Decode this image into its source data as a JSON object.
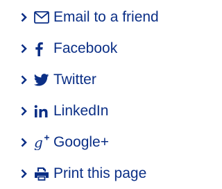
{
  "share": {
    "color": "#0b2f86",
    "items": [
      {
        "icon": "envelope-icon",
        "label": "Email to a friend"
      },
      {
        "icon": "facebook-icon",
        "label": "Facebook"
      },
      {
        "icon": "twitter-icon",
        "label": "Twitter"
      },
      {
        "icon": "linkedin-icon",
        "label": "LinkedIn"
      },
      {
        "icon": "google-plus-icon",
        "label": "Google+"
      },
      {
        "icon": "printer-icon",
        "label": "Print this page"
      }
    ]
  }
}
